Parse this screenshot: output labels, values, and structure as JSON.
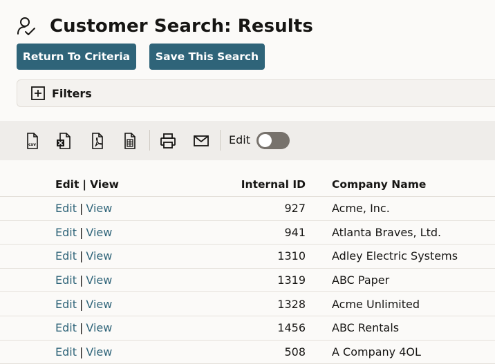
{
  "page": {
    "title": "Customer Search: Results",
    "title_icon": "user-check-icon"
  },
  "buttons": {
    "return_label": "Return To Criteria",
    "save_label": "Save This Search"
  },
  "filters": {
    "label": "Filters",
    "icon": "plus-box-icon"
  },
  "toolbar": {
    "icons": [
      "csv-export-icon",
      "excel-export-icon",
      "pdf-export-icon",
      "spreadsheet-export-icon",
      "print-icon",
      "email-icon"
    ],
    "edit_label": "Edit",
    "edit_toggle_on": false
  },
  "table": {
    "headers": {
      "edit_view": {
        "edit": "Edit",
        "sep": "|",
        "view": "View"
      },
      "internal_id": "Internal ID",
      "company_name": "Company Name"
    },
    "rows": [
      {
        "edit": "Edit",
        "sep": "|",
        "view": "View",
        "internal_id": "927",
        "company_name": "Acme, Inc."
      },
      {
        "edit": "Edit",
        "sep": "|",
        "view": "View",
        "internal_id": "941",
        "company_name": "Atlanta Braves, Ltd."
      },
      {
        "edit": "Edit",
        "sep": "|",
        "view": "View",
        "internal_id": "1310",
        "company_name": "Adley Electric Systems"
      },
      {
        "edit": "Edit",
        "sep": "|",
        "view": "View",
        "internal_id": "1319",
        "company_name": "ABC Paper"
      },
      {
        "edit": "Edit",
        "sep": "|",
        "view": "View",
        "internal_id": "1328",
        "company_name": "Acme Unlimited"
      },
      {
        "edit": "Edit",
        "sep": "|",
        "view": "View",
        "internal_id": "1456",
        "company_name": "ABC Rentals"
      },
      {
        "edit": "Edit",
        "sep": "|",
        "view": "View",
        "internal_id": "508",
        "company_name": "A Company 4OL"
      }
    ]
  },
  "colors": {
    "accent": "#2f6479",
    "background": "#fbfaf8",
    "toolbar_bg": "#efedea",
    "text": "#161513"
  }
}
